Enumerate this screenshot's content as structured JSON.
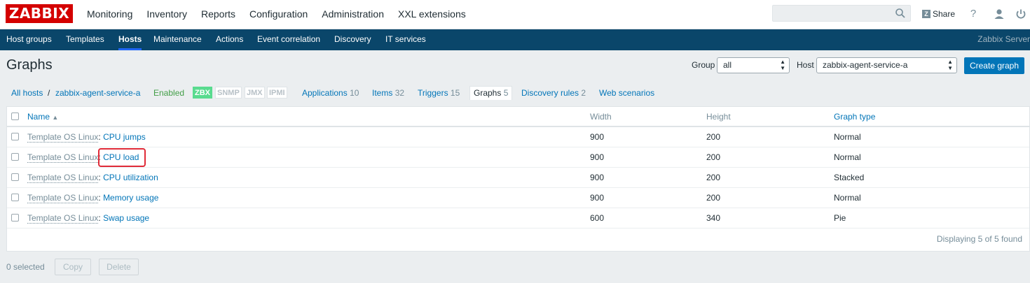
{
  "header": {
    "logo_text": "ZABBIX",
    "main_menu": [
      "Monitoring",
      "Inventory",
      "Reports",
      "Configuration",
      "Administration",
      "XXL extensions"
    ],
    "share_label": "Share",
    "help_label": "?",
    "server_name": "Zabbix Server"
  },
  "sub_menu": [
    "Host groups",
    "Templates",
    "Hosts",
    "Maintenance",
    "Actions",
    "Event correlation",
    "Discovery",
    "IT services"
  ],
  "page": {
    "title": "Graphs",
    "group_label": "Group",
    "group_value": "all",
    "host_label": "Host",
    "host_value": "zabbix-agent-service-a",
    "create_button": "Create graph"
  },
  "breadcrumb": {
    "all_hosts": "All hosts",
    "separator": "/",
    "host": "zabbix-agent-service-a",
    "status": "Enabled",
    "badges": [
      "ZBX",
      "SNMP",
      "JMX",
      "IPMI"
    ],
    "tabs": [
      {
        "label": "Applications",
        "count": "10"
      },
      {
        "label": "Items",
        "count": "32"
      },
      {
        "label": "Triggers",
        "count": "15"
      },
      {
        "label": "Graphs",
        "count": "5"
      },
      {
        "label": "Discovery rules",
        "count": "2"
      },
      {
        "label": "Web scenarios",
        "count": ""
      }
    ]
  },
  "table": {
    "columns": [
      "Name",
      "Width",
      "Height",
      "Graph type"
    ],
    "sort_indicator": "▲",
    "rows": [
      {
        "template": "Template OS Linux",
        "name": "CPU jumps",
        "width": "900",
        "height": "200",
        "type": "Normal"
      },
      {
        "template": "Template OS Linux",
        "name": "CPU load",
        "width": "900",
        "height": "200",
        "type": "Normal"
      },
      {
        "template": "Template OS Linux",
        "name": "CPU utilization",
        "width": "900",
        "height": "200",
        "type": "Stacked"
      },
      {
        "template": "Template OS Linux",
        "name": "Memory usage",
        "width": "900",
        "height": "200",
        "type": "Normal"
      },
      {
        "template": "Template OS Linux",
        "name": "Swap usage",
        "width": "600",
        "height": "340",
        "type": "Pie"
      }
    ],
    "footer": "Displaying 5 of 5 found"
  },
  "actions": {
    "selected": "0 selected",
    "copy": "Copy",
    "delete": "Delete"
  },
  "colors": {
    "logo": "#d40000",
    "subnav": "#0a466a",
    "link": "#0275b8",
    "enabled": "#429e47",
    "zbx_badge": "#59db8f",
    "highlight": "#e02b38"
  }
}
